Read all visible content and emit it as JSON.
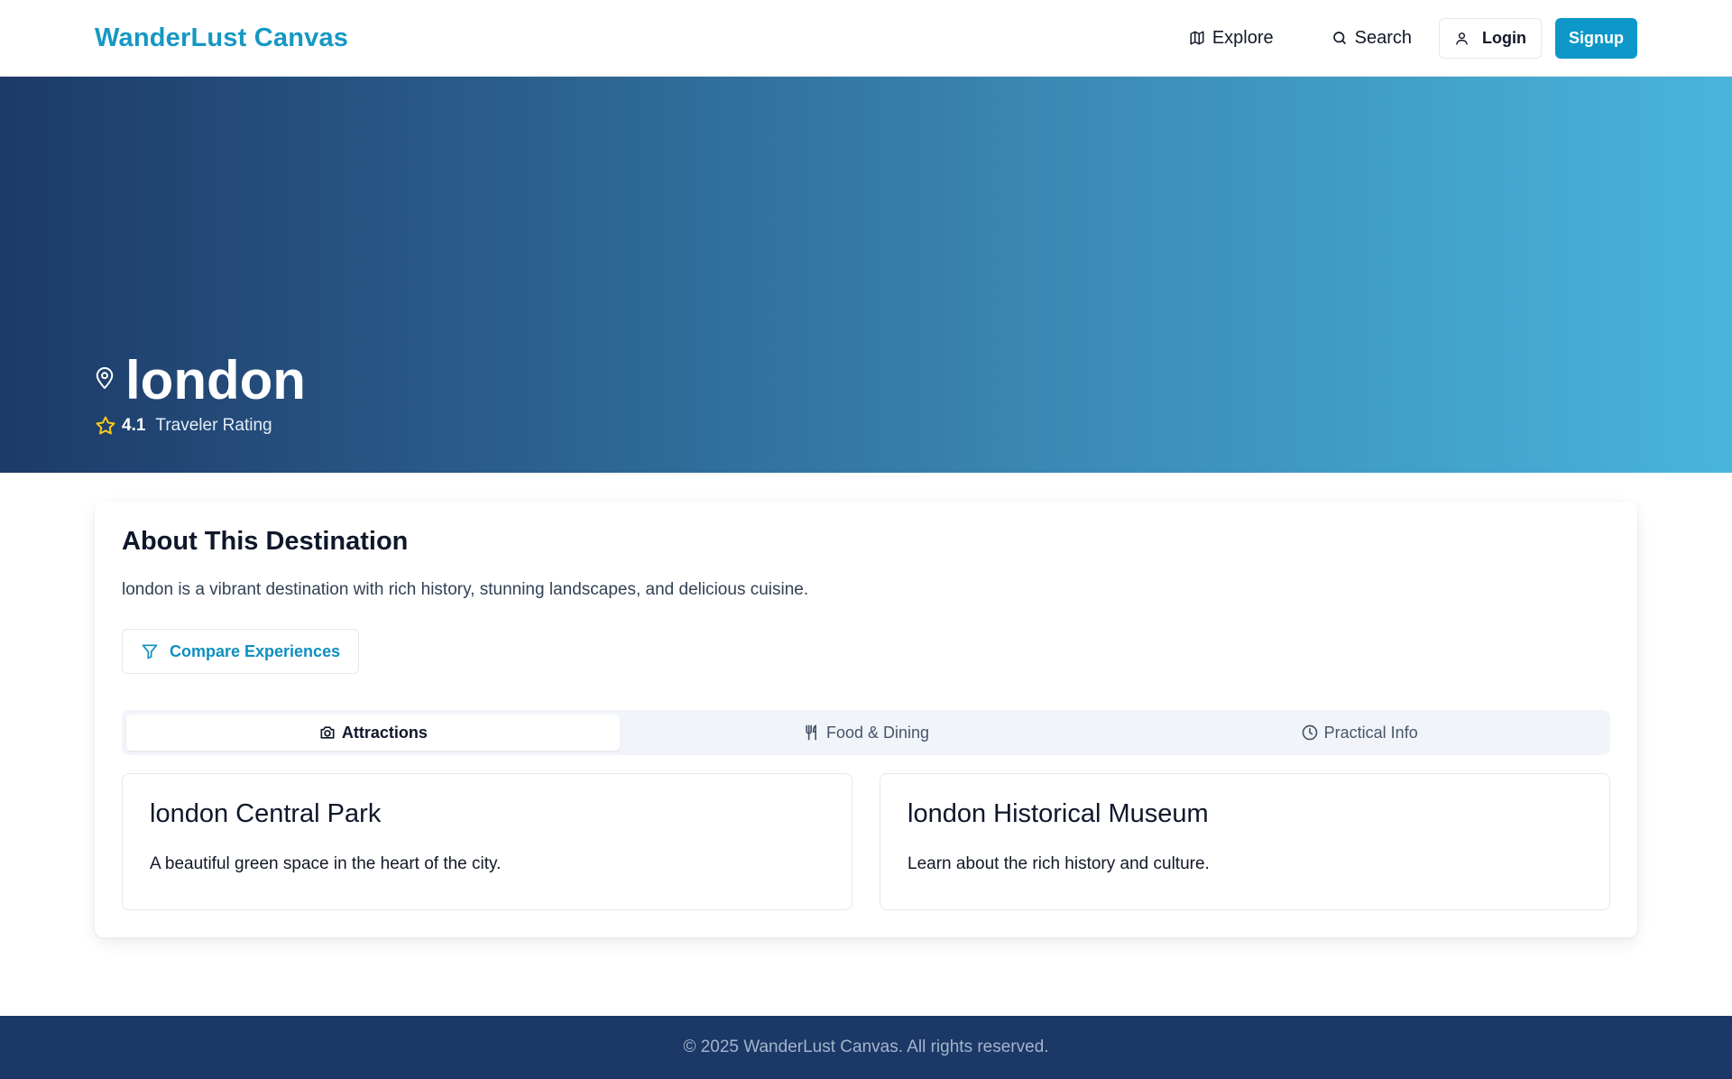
{
  "brand": {
    "name": "WanderLust Canvas"
  },
  "nav": {
    "explore": "Explore",
    "search": "Search",
    "login": "Login",
    "signup": "Signup"
  },
  "hero": {
    "title": "london",
    "rating_value": "4.1",
    "rating_label": "Traveler Rating",
    "location_icon": "map-pin-icon",
    "star_icon": "star-icon"
  },
  "about": {
    "title": "About This Destination",
    "description": "london is a vibrant destination with rich history, stunning landscapes, and delicious cuisine.",
    "compare_label": "Compare Experiences"
  },
  "tabs": [
    {
      "label": "Attractions",
      "icon": "camera-icon",
      "active": true
    },
    {
      "label": "Food & Dining",
      "icon": "utensils-icon",
      "active": false
    },
    {
      "label": "Practical Info",
      "icon": "clock-icon",
      "active": false
    }
  ],
  "attractions": [
    {
      "title": "london Central Park",
      "description": "A beautiful green space in the heart of the city."
    },
    {
      "title": "london Historical Museum",
      "description": "Learn about the rich history and culture."
    }
  ],
  "footer": {
    "text": "© 2025 WanderLust Canvas. All rights reserved."
  },
  "colors": {
    "brand": "#1598c3",
    "signup_bg": "#0e98c9",
    "hero_start": "#1d3a68",
    "hero_end": "#49b5db",
    "footer_bg": "#1c3866",
    "star": "#facc15"
  }
}
